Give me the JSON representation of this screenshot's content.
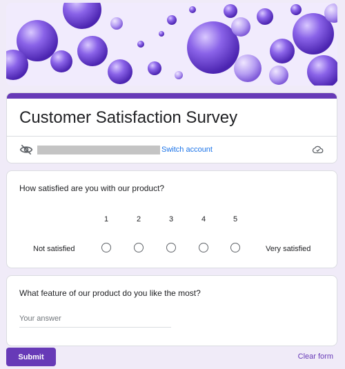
{
  "form": {
    "title": "Customer Satisfaction Survey",
    "account": {
      "switch_label": "Switch account",
      "icons": [
        "eye-off-icon",
        "cloud-check-icon"
      ]
    }
  },
  "questions": [
    {
      "text": "How satisfied are you with our product?",
      "type": "linear-scale",
      "scale": [
        "1",
        "2",
        "3",
        "4",
        "5"
      ],
      "min_label": "Not satisfied",
      "max_label": "Very satisfied"
    },
    {
      "text": "What feature of our product do you like the most?",
      "type": "short-answer",
      "placeholder": "Your answer"
    }
  ],
  "footer": {
    "submit_label": "Submit",
    "clear_label": "Clear form"
  },
  "colors": {
    "accent": "#673ab7",
    "background": "#f0ebf8",
    "link": "#1a73e8"
  }
}
